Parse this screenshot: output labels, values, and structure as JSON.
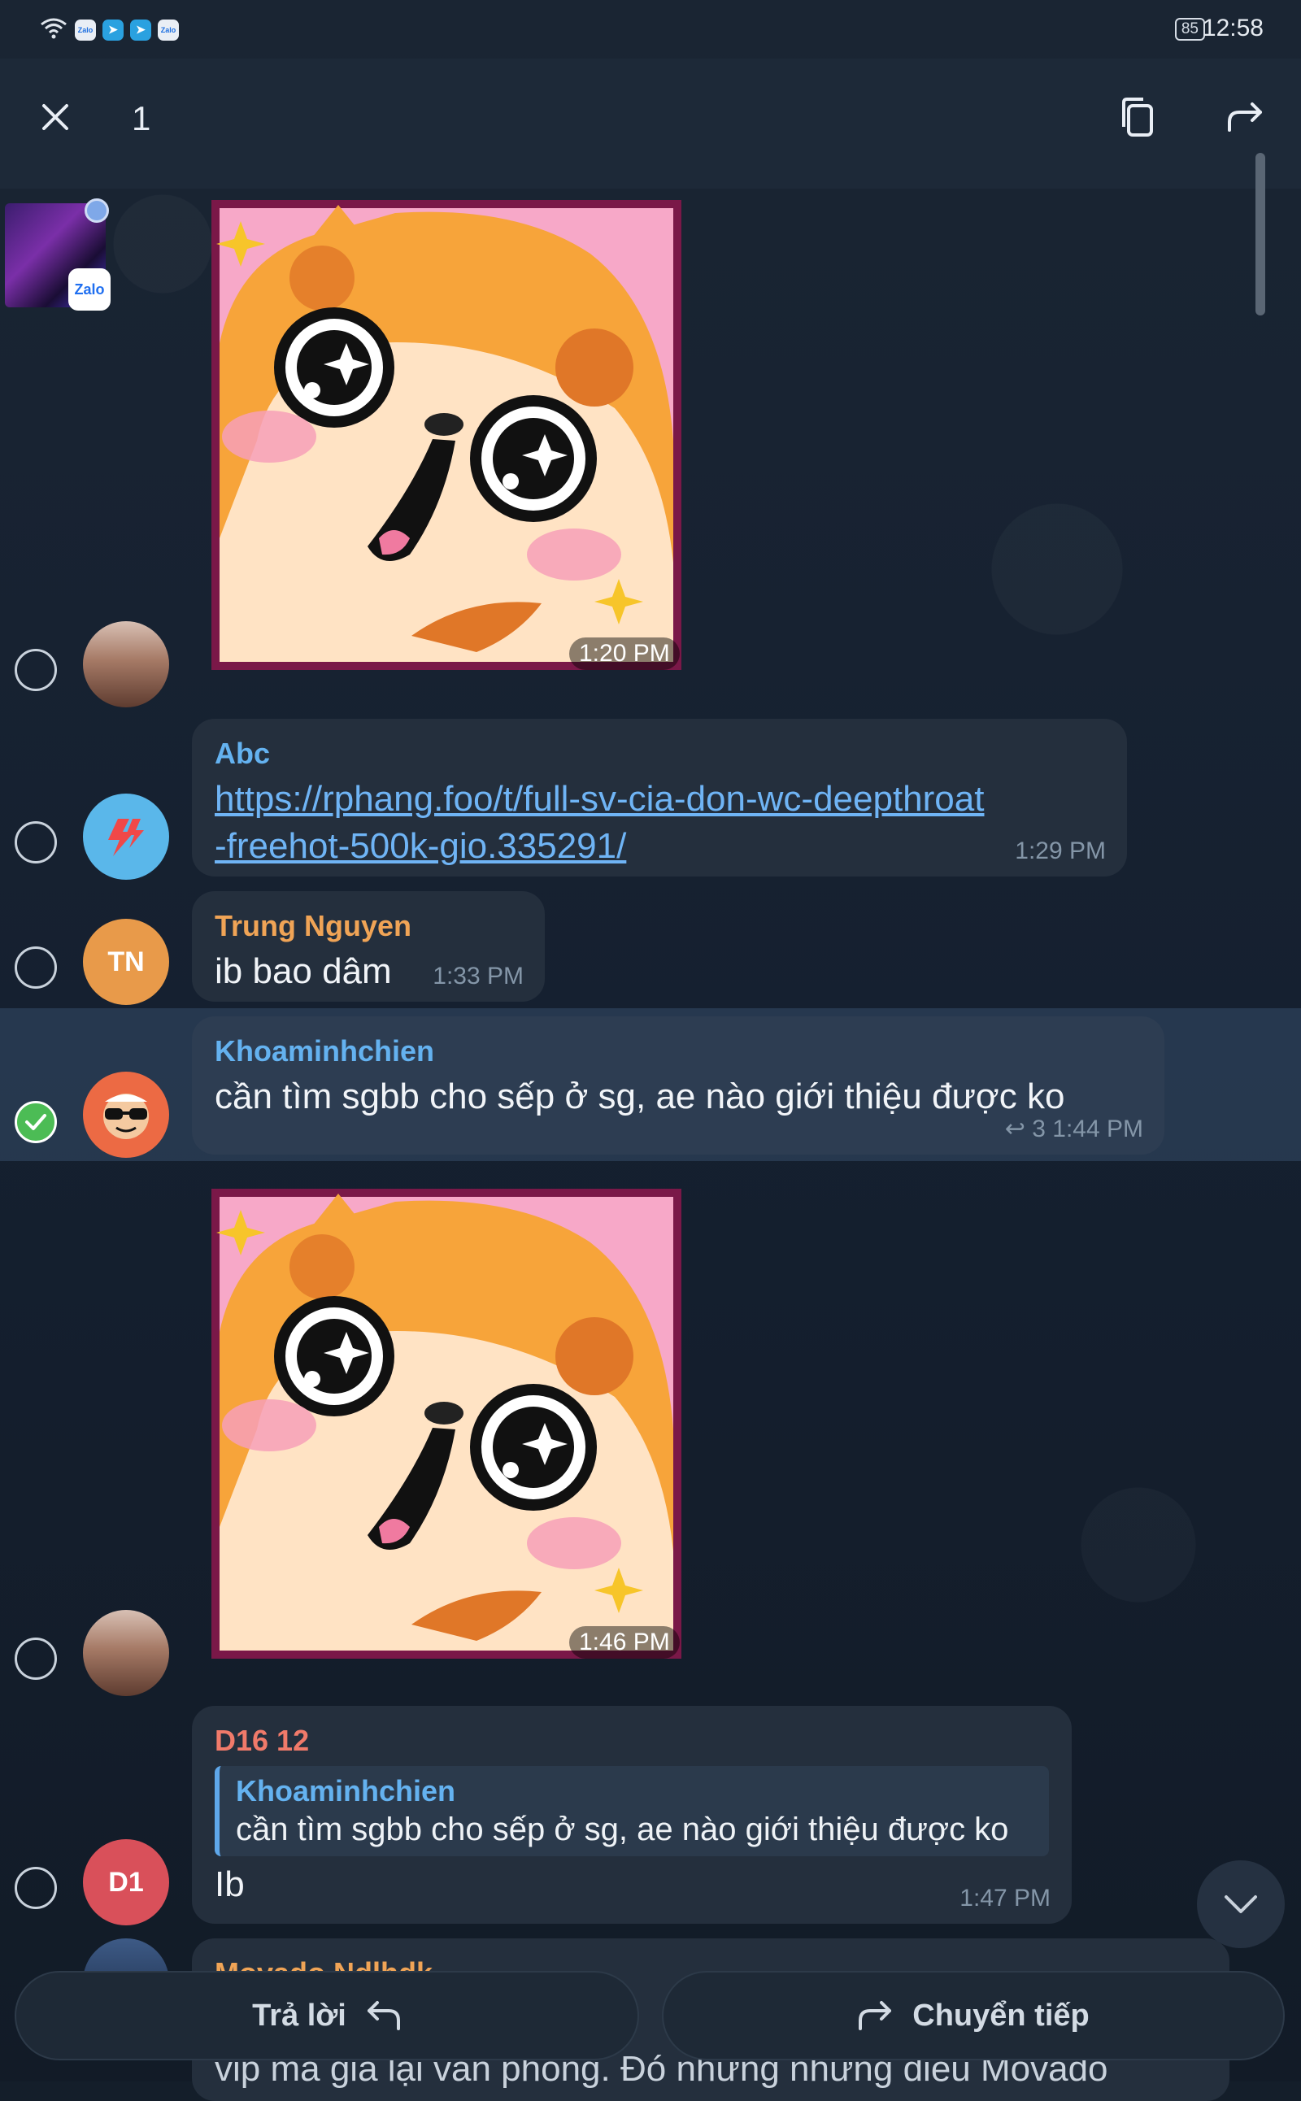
{
  "status": {
    "battery": "85",
    "time": "12:58",
    "apps": [
      "Zalo",
      "Telegram",
      "Telegram",
      "Zalo"
    ]
  },
  "header": {
    "selected_count": "1"
  },
  "chat_thumb": {
    "badge": "Zalo"
  },
  "messages": [
    {
      "type": "sticker",
      "time": "1:20 PM"
    },
    {
      "sender": "Abc",
      "sender_color": "#64b2f0",
      "link_line1": "https://rphang.foo/t/full-sv-cia-don-wc-deepthroat",
      "link_line2": "-freehot-500k-gio.335291/",
      "time": "1:29 PM"
    },
    {
      "sender": "Trung Nguyen",
      "sender_color": "#f0a456",
      "avatar": "TN",
      "text": "ib bao dâm",
      "time": "1:33 PM"
    },
    {
      "sender": "Khoaminhchien",
      "sender_color": "#64b2f0",
      "text": "cần tìm sgbb cho sếp ở sg, ae nào giới thiệu được ko",
      "replies": "3",
      "time": "1:44 PM"
    },
    {
      "type": "sticker",
      "time": "1:46 PM"
    },
    {
      "sender": "D16 12",
      "sender_color": "#f07a6a",
      "avatar": "D1",
      "quote_name": "Khoaminhchien",
      "quote_text": "cần tìm sgbb cho sếp ở sg, ae nào giới thiệu được ko",
      "text": "Ib",
      "time": "1:47 PM"
    },
    {
      "sender": "Movado Ndlhdk",
      "sender_color": "#f0a456",
      "text_partial": "vip mà giá lại văn phòng. Đó những nhưng điều Movado"
    }
  ],
  "actions": {
    "reply": "Trả lời",
    "forward": "Chuyển tiếp"
  },
  "colors": {
    "accent": "#64b2f0",
    "check": "#4cbc55"
  }
}
